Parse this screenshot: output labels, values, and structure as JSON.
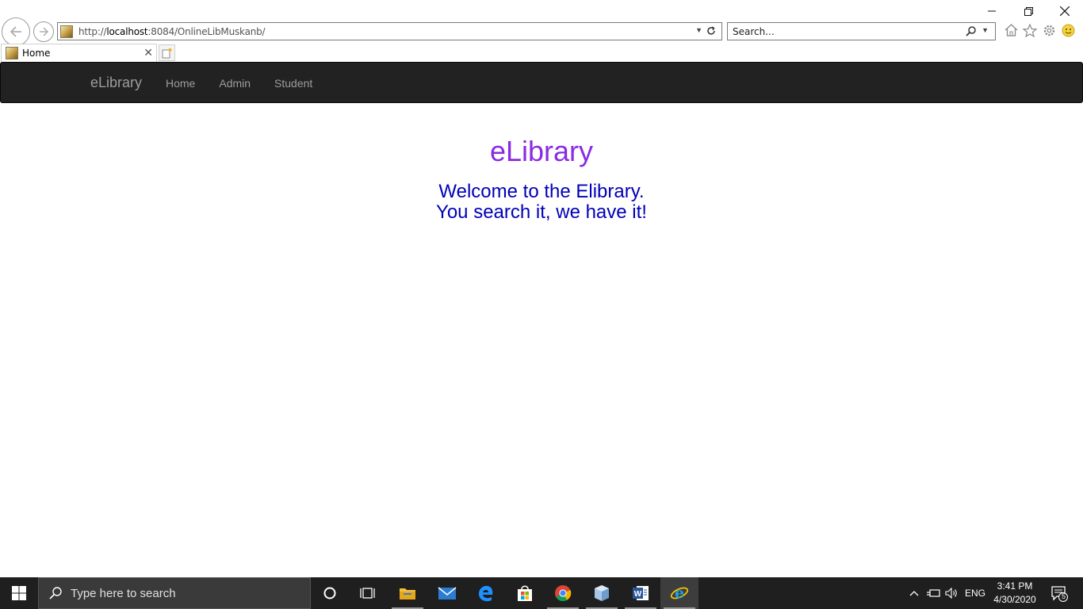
{
  "browser": {
    "url_prefix": "http://",
    "url_host": "localhost",
    "url_rest": ":8084/OnlineLibMuskanb/",
    "search_placeholder": "Search...",
    "tab_title": "Home"
  },
  "navbar": {
    "brand": "eLibrary",
    "links": [
      "Home",
      "Admin",
      "Student"
    ]
  },
  "main": {
    "title": "eLibrary",
    "welcome_line1": "Welcome to the Elibrary.",
    "welcome_line2": "You search it, we have it!",
    "title_color": "#8a2be2",
    "welcome_color": "#0000b8"
  },
  "taskbar": {
    "search_placeholder": "Type here to search",
    "language": "ENG",
    "time": "3:41 PM",
    "date": "4/30/2020",
    "notification_count": "5",
    "apps": [
      "cortana-icon",
      "task-view-icon",
      "file-explorer-icon",
      "mail-icon",
      "edge-icon",
      "store-icon",
      "chrome-icon",
      "package-icon",
      "word-icon",
      "internet-explorer-icon"
    ]
  }
}
